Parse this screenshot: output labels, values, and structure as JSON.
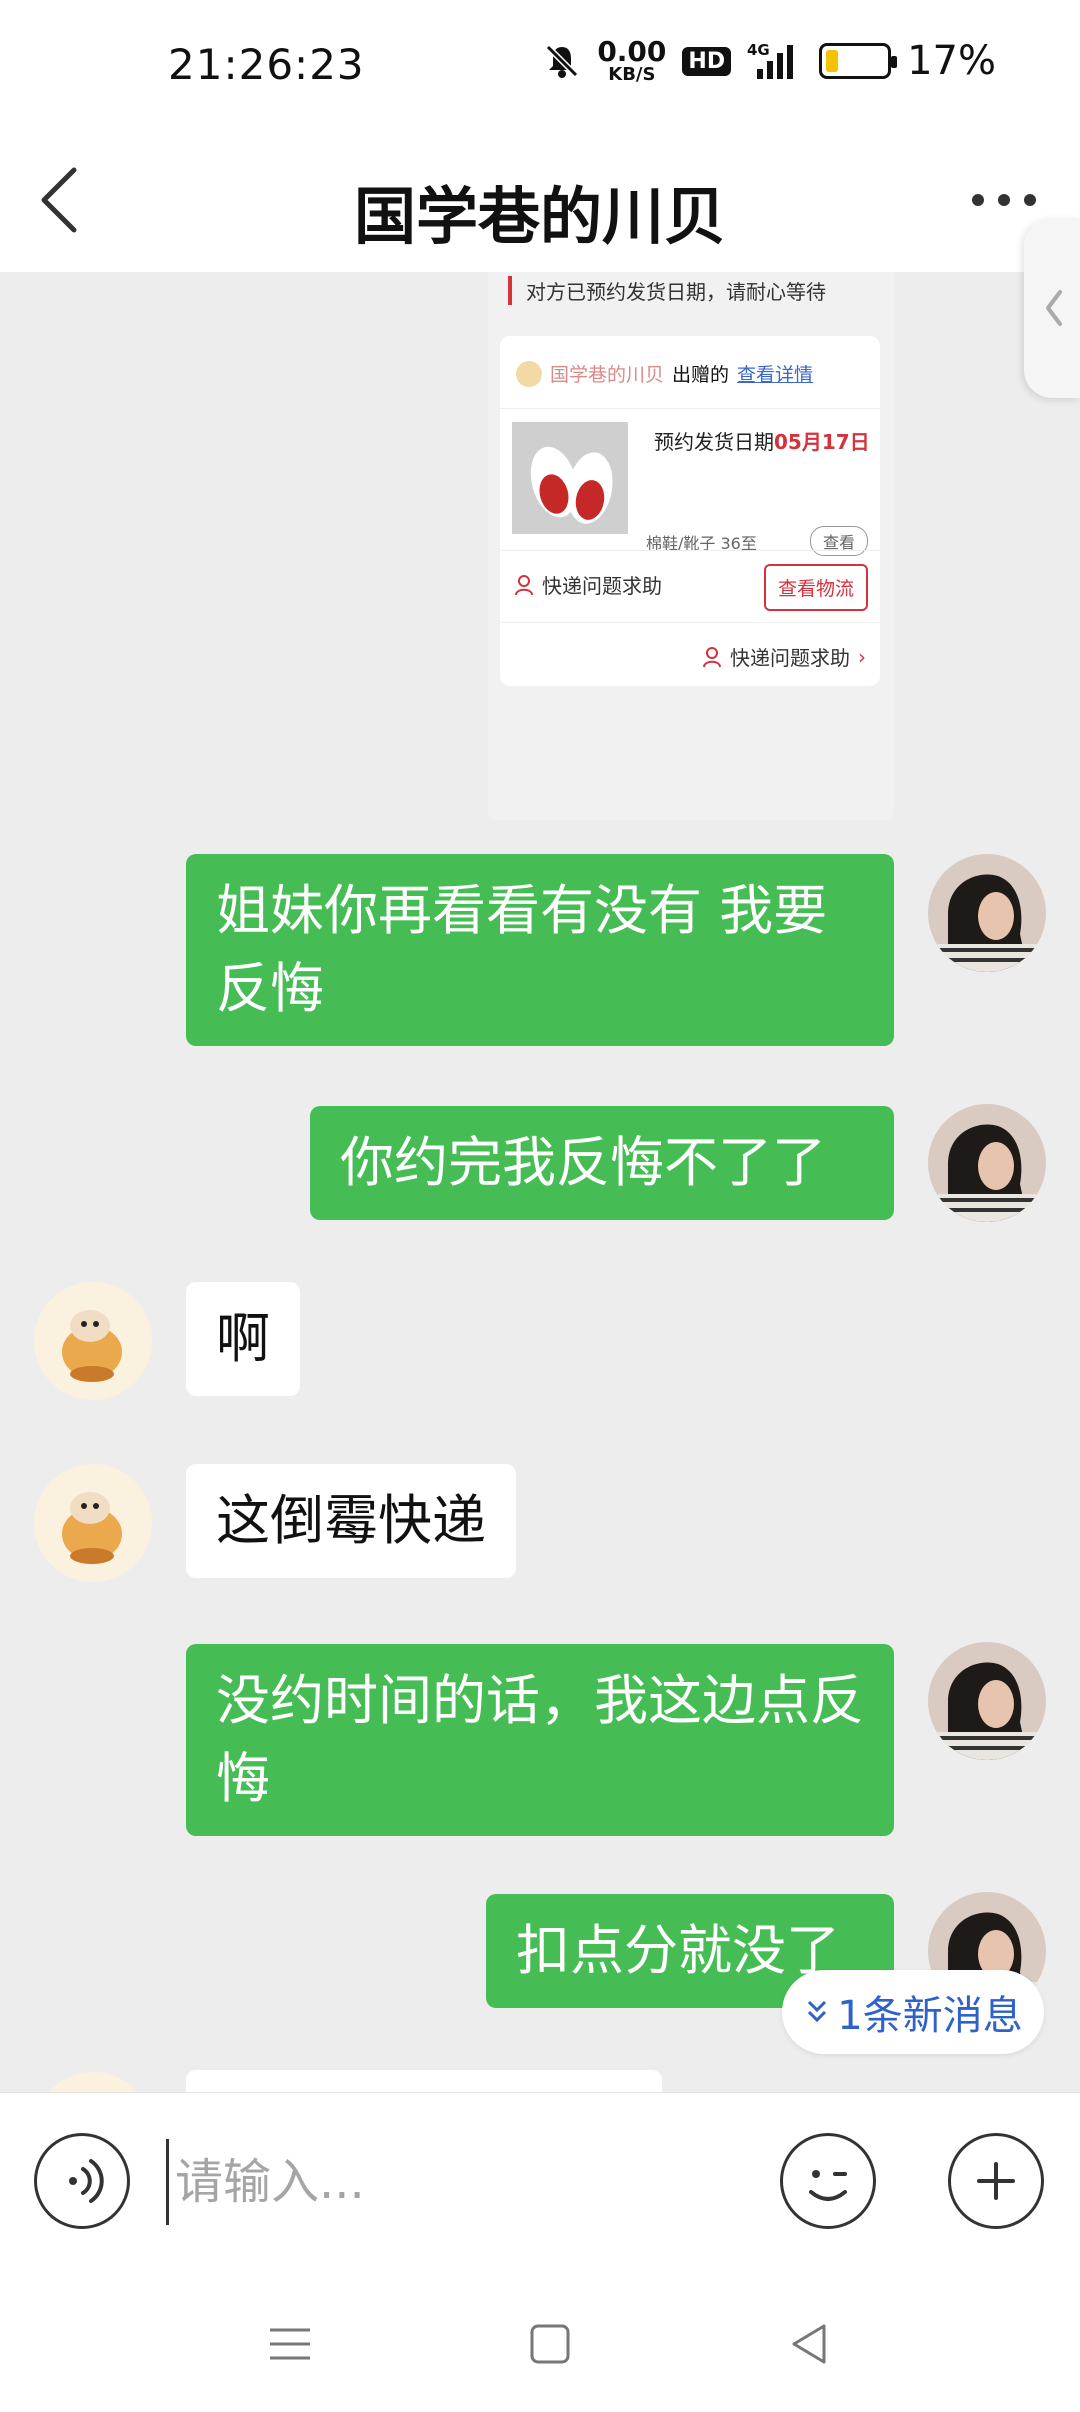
{
  "status_bar": {
    "time": "21:26:23",
    "net_speed_value": "0.00",
    "net_speed_unit": "KB/S",
    "hd_label": "HD",
    "network": "4G",
    "battery_percent": "17%",
    "battery_level": 0.17,
    "battery_color": "#f4c300"
  },
  "header": {
    "title": "国学巷的川贝"
  },
  "image_message": {
    "top_note": "对方已预约发货日期，请耐心等待",
    "seller": "国学巷的川贝",
    "donated_text": "出赠的",
    "view_details": "查看详情",
    "date_label": "预约发货日期",
    "date_value": "05月17日",
    "product": "棉鞋/靴子 36至",
    "view_small": "查看",
    "help_text": "快递问题求助",
    "logistics_button": "查看物流",
    "help_link": "快递问题求助"
  },
  "messages": [
    {
      "direction": "out",
      "text": "姐妹你再看看有没有  我要反悔"
    },
    {
      "direction": "out",
      "text": "你约完我反悔不了了"
    },
    {
      "direction": "in",
      "text": "啊"
    },
    {
      "direction": "in",
      "text": "这倒霉快递"
    },
    {
      "direction": "out",
      "text": "没约时间的话，我这边点反悔"
    },
    {
      "direction": "out",
      "text": "扣点分就没了"
    }
  ],
  "new_message_pill": {
    "label": "1条新消息"
  },
  "input_bar": {
    "placeholder": "请输入..."
  },
  "colors": {
    "outgoing_bubble": "#46bd54",
    "incoming_bubble": "#ffffff",
    "accent_red": "#d6323c",
    "link_blue": "#2f61c8"
  },
  "icons": {
    "back": "chevron-left-icon",
    "more": "more-dots-icon",
    "voice": "voice-icon",
    "emoji": "emoji-icon",
    "plus": "plus-icon",
    "nav_menu": "menu-icon",
    "nav_home": "home-square-icon",
    "nav_back": "triangle-back-icon"
  }
}
